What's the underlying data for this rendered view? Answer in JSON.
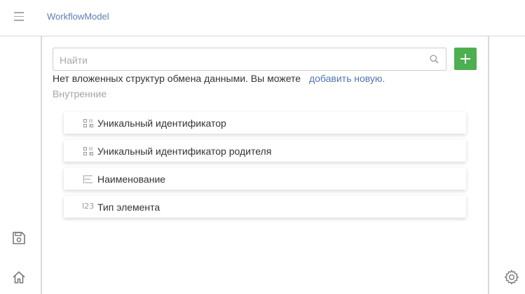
{
  "header": {
    "title": "WorkflowModel"
  },
  "search": {
    "placeholder": "Найти",
    "value": ""
  },
  "notice": {
    "text": "Нет вложенных структур обмена данными. Вы можете",
    "link": "добавить новую."
  },
  "section": {
    "label": "Внутренние"
  },
  "fields": [
    {
      "label": "Уникальный идентификатор",
      "icon": "guid-icon"
    },
    {
      "label": "Уникальный идентификатор родителя",
      "icon": "guid-icon"
    },
    {
      "label": "Наименование",
      "icon": "text-icon"
    },
    {
      "label": "Тип элемента",
      "icon": "number-icon",
      "icon_text": "I23"
    }
  ],
  "colors": {
    "accent_link": "#4d77b3",
    "add_button": "#4caf50",
    "title": "#5b7fb0"
  }
}
